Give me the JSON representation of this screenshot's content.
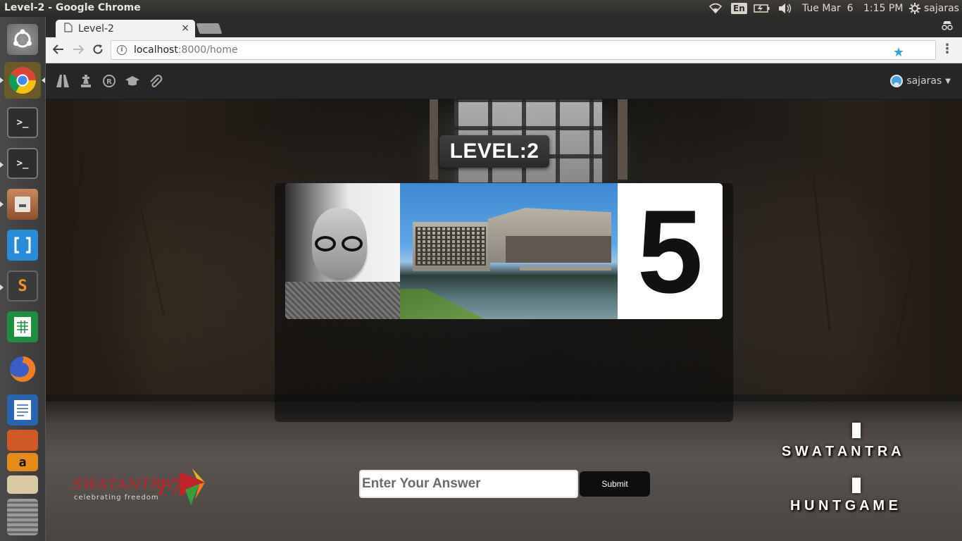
{
  "system": {
    "window_title": "Level-2 - Google Chrome",
    "input_lang": "En",
    "datetime": "Tue Mar  6",
    "clock": "1:15 PM",
    "user": "sajaras"
  },
  "browser": {
    "tab_title": "Level-2",
    "tab_close": "×",
    "url_host": "localhost",
    "url_path": ":8000/home"
  },
  "app_nav": {
    "icons": [
      "road-icon",
      "chess-icon",
      "registered-icon",
      "graduation-cap-icon",
      "paperclip-icon"
    ],
    "username": "sajaras"
  },
  "level": {
    "title": "LEVEL:2",
    "clue_number": "5"
  },
  "form": {
    "answer_placeholder": "Enter Your Answer",
    "submit_label": "Submit"
  },
  "logo": {
    "name": "SWATANTRA",
    "year": "17",
    "tagline": "celebrating freedom"
  },
  "brand": {
    "line1": "S W A T A N T R A",
    "line2": "H U N T G A M E"
  },
  "colors": {
    "logo_red": "#c0242a",
    "star_blue": "#3aa0e0",
    "nav_bg": "#262626"
  }
}
